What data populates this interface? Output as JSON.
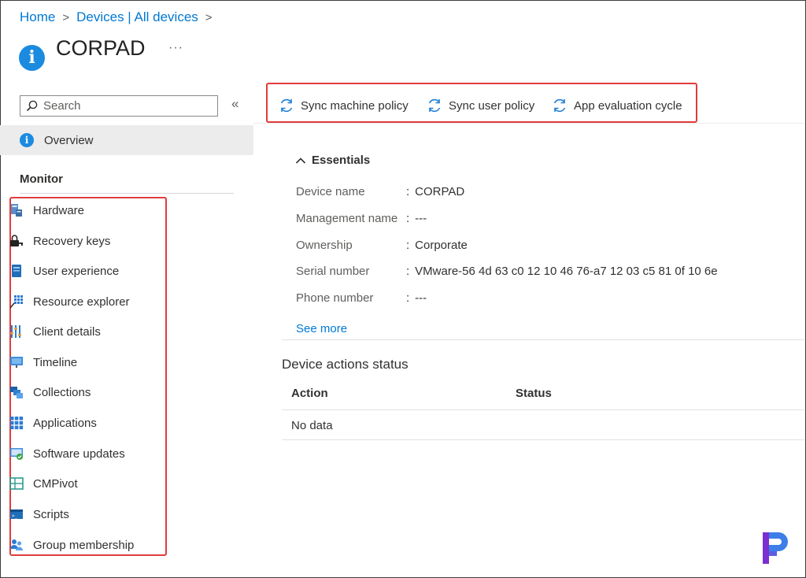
{
  "breadcrumb": {
    "items": [
      "Home",
      "Devices | All devices"
    ],
    "separator": ">"
  },
  "header": {
    "title": "CORPAD",
    "more": "···",
    "icon": "info-icon"
  },
  "sidebar": {
    "search": {
      "placeholder": "Search",
      "value": ""
    },
    "collapse": "«",
    "overview_label": "Overview",
    "section_label": "Monitor",
    "items": [
      {
        "label": "Hardware",
        "icon": "hardware-icon"
      },
      {
        "label": "Recovery keys",
        "icon": "key-icon"
      },
      {
        "label": "User experience",
        "icon": "user-experience-icon"
      },
      {
        "label": "Resource explorer",
        "icon": "resource-explorer-icon"
      },
      {
        "label": "Client details",
        "icon": "client-details-icon"
      },
      {
        "label": "Timeline",
        "icon": "timeline-icon"
      },
      {
        "label": "Collections",
        "icon": "collections-icon"
      },
      {
        "label": "Applications",
        "icon": "applications-icon"
      },
      {
        "label": "Software updates",
        "icon": "software-updates-icon"
      },
      {
        "label": "CMPivot",
        "icon": "cmpivot-icon"
      },
      {
        "label": "Scripts",
        "icon": "scripts-icon"
      },
      {
        "label": "Group membership",
        "icon": "group-membership-icon"
      }
    ]
  },
  "commands": [
    {
      "label": "Sync machine policy",
      "icon": "sync-icon"
    },
    {
      "label": "Sync user policy",
      "icon": "sync-icon"
    },
    {
      "label": "App evaluation cycle",
      "icon": "sync-icon"
    }
  ],
  "essentials": {
    "toggle_label": "Essentials",
    "properties": [
      {
        "label": "Device name",
        "value": "CORPAD"
      },
      {
        "label": "Management name",
        "value": "---"
      },
      {
        "label": "Ownership",
        "value": "Corporate"
      },
      {
        "label": "Serial number",
        "value": "VMware-56 4d 63 c0 12 10 46 76-a7 12 03 c5 81 0f 10 6e"
      },
      {
        "label": "Phone number",
        "value": "---"
      }
    ],
    "see_more": "See more"
  },
  "device_actions": {
    "title": "Device actions status",
    "columns": [
      "Action",
      "Status"
    ],
    "empty_text": "No data"
  },
  "colors": {
    "accent": "#0078d4",
    "highlight_border": "#e03c3c",
    "selected_bg": "#ececec"
  }
}
